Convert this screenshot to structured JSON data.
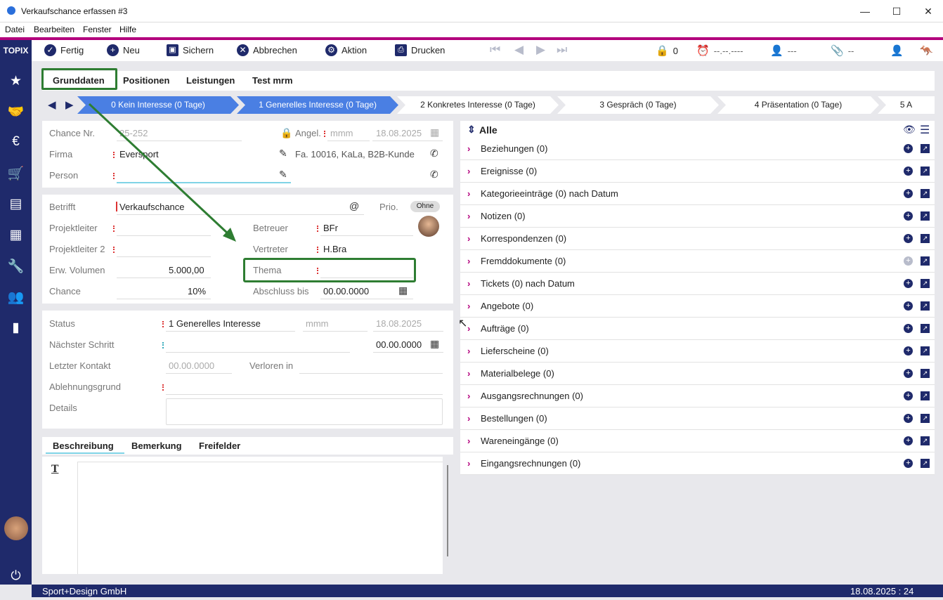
{
  "window": {
    "title": "Verkaufschance erfassen #3",
    "minimize": "—",
    "maximize": "☐",
    "close": "✕"
  },
  "menu": [
    "Datei",
    "Bearbeiten",
    "Fenster",
    "Hilfe"
  ],
  "sidebar": {
    "logo": "TOPIX",
    "icons": [
      "star-icon",
      "handshake-icon",
      "invoice-icon",
      "cart-icon",
      "warehouse-icon",
      "box-icon",
      "wrench-icon",
      "people-icon",
      "chart-icon"
    ],
    "power_icon": "power-icon"
  },
  "toolbar": {
    "fertig": "Fertig",
    "neu": "Neu",
    "sichern": "Sichern",
    "abbrechen": "Abbrechen",
    "aktion": "Aktion",
    "drucken": "Drucken",
    "lock_count": "0",
    "alarm": "--.--.----",
    "user": "---",
    "clip": "--"
  },
  "tabs": [
    "Grunddaten",
    "Positionen",
    "Leistungen",
    "Test mrm"
  ],
  "steps": [
    "0 Kein Interesse (0 Tage)",
    "1 Generelles Interesse (0 Tage)",
    "2 Konkretes Interesse (0 Tage)",
    "3 Gespräch (0 Tage)",
    "4 Präsentation (0 Tage)",
    "5 A"
  ],
  "chance": {
    "nr_label": "Chance Nr.",
    "nr_value": "25-252",
    "angel_label": "Angel.",
    "angel_user": "mmm",
    "angel_date": "18.08.2025",
    "firma_label": "Firma",
    "firma_value": "Eversport",
    "firma_info": "Fa. 10016, KaLa, B2B-Kunde",
    "person_label": "Person",
    "person_value": ""
  },
  "details": {
    "betrifft_label": "Betrifft",
    "betrifft_value": "Verkaufschance",
    "prio_label": "Prio.",
    "prio_value": "Ohne",
    "projektleiter_label": "Projektleiter",
    "betreuer_label": "Betreuer",
    "betreuer_value": "BFr",
    "projektleiter2_label": "Projektleiter 2",
    "vertreter_label": "Vertreter",
    "vertreter_value": "H.Bra",
    "volumen_label": "Erw. Volumen",
    "volumen_value": "5.000,00",
    "thema_label": "Thema",
    "chance_label": "Chance",
    "chance_value": "10%",
    "abschluss_label": "Abschluss bis",
    "abschluss_value": "00.00.0000"
  },
  "status": {
    "status_label": "Status",
    "status_value": "1 Generelles Interesse",
    "status_user": "mmm",
    "status_date": "18.08.2025",
    "next_label": "Nächster Schritt",
    "next_date": "00.00.0000",
    "last_label": "Letzter Kontakt",
    "last_value": "00.00.0000",
    "lost_label": "Verloren in",
    "reject_label": "Ablehnungsgrund",
    "details_label": "Details"
  },
  "bottom_tabs": [
    "Beschreibung",
    "Bemerkung",
    "Freifelder"
  ],
  "right": {
    "header": "Alle",
    "items": [
      {
        "label": "Beziehungen (0)",
        "disabled": false
      },
      {
        "label": "Ereignisse (0)",
        "disabled": false
      },
      {
        "label": "Kategorieeinträge (0) nach Datum",
        "disabled": false
      },
      {
        "label": "Notizen (0)",
        "disabled": false
      },
      {
        "label": "Korrespondenzen (0)",
        "disabled": false
      },
      {
        "label": "Fremddokumente (0)",
        "disabled": true
      },
      {
        "label": "Tickets (0) nach Datum",
        "disabled": false
      },
      {
        "label": "Angebote (0)",
        "disabled": false
      },
      {
        "label": "Aufträge (0)",
        "disabled": false
      },
      {
        "label": "Lieferscheine (0)",
        "disabled": false
      },
      {
        "label": "Materialbelege (0)",
        "disabled": false
      },
      {
        "label": "Ausgangsrechnungen (0)",
        "disabled": false
      },
      {
        "label": "Bestellungen (0)",
        "disabled": false
      },
      {
        "label": "Wareneingänge (0)",
        "disabled": false
      },
      {
        "label": "Eingangsrechnungen (0)",
        "disabled": false
      }
    ]
  },
  "statusbar": {
    "company": "Sport+Design GmbH",
    "datetime": "18.08.2025 : 24"
  },
  "colors": {
    "navy": "#1f2a6b",
    "accent": "#b3007d",
    "step_active": "#4a7fe3",
    "highlight": "#2e7d32"
  }
}
